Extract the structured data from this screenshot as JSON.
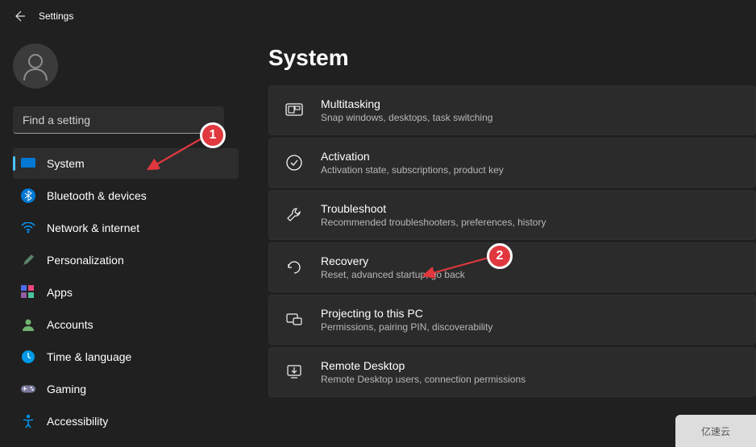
{
  "header": {
    "title": "Settings"
  },
  "search": {
    "placeholder": "Find a setting"
  },
  "sidebar": {
    "items": [
      {
        "label": "System"
      },
      {
        "label": "Bluetooth & devices"
      },
      {
        "label": "Network & internet"
      },
      {
        "label": "Personalization"
      },
      {
        "label": "Apps"
      },
      {
        "label": "Accounts"
      },
      {
        "label": "Time & language"
      },
      {
        "label": "Gaming"
      },
      {
        "label": "Accessibility"
      }
    ]
  },
  "page": {
    "title": "System"
  },
  "settings": [
    {
      "title": "Multitasking",
      "desc": "Snap windows, desktops, task switching"
    },
    {
      "title": "Activation",
      "desc": "Activation state, subscriptions, product key"
    },
    {
      "title": "Troubleshoot",
      "desc": "Recommended troubleshooters, preferences, history"
    },
    {
      "title": "Recovery",
      "desc": "Reset, advanced startup, go back"
    },
    {
      "title": "Projecting to this PC",
      "desc": "Permissions, pairing PIN, discoverability"
    },
    {
      "title": "Remote Desktop",
      "desc": "Remote Desktop users, connection permissions"
    }
  ],
  "annotations": {
    "badge1": "1",
    "badge2": "2"
  },
  "watermark": "亿速云"
}
